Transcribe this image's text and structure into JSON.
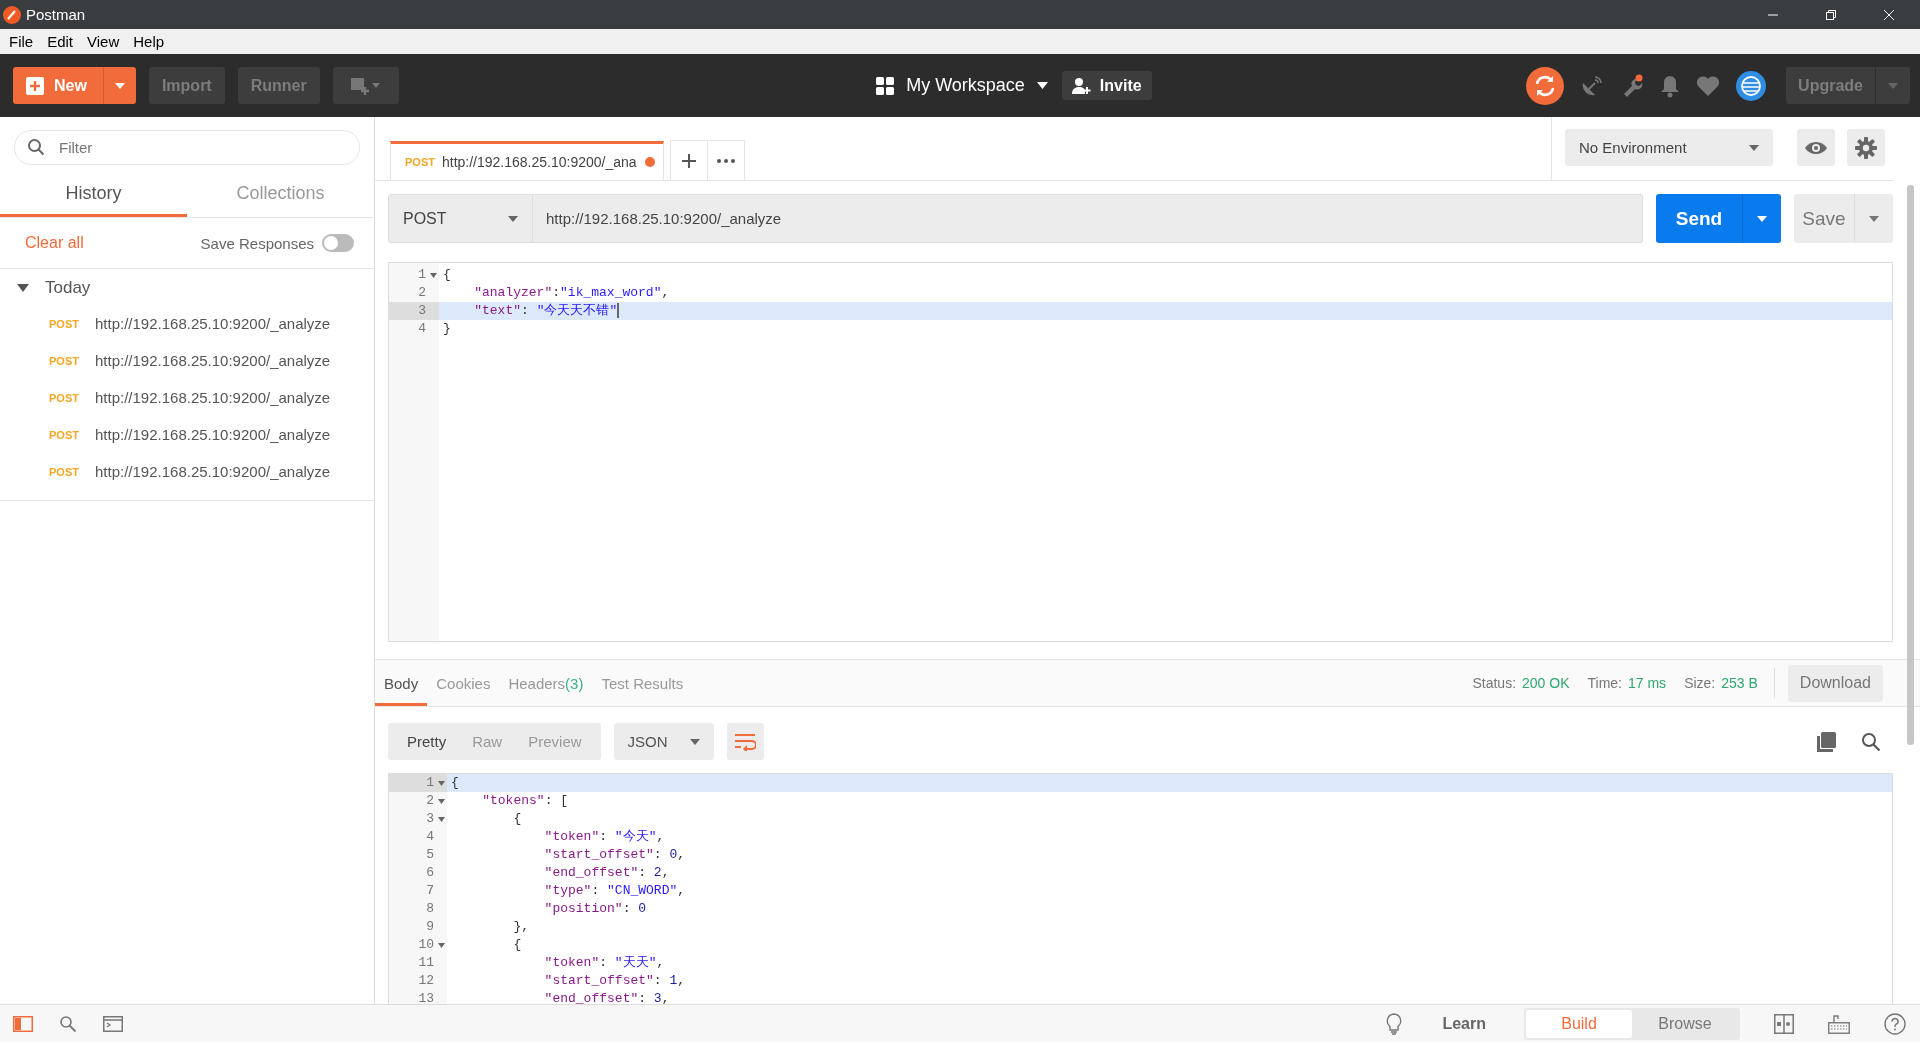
{
  "window": {
    "title": "Postman"
  },
  "menu": [
    "File",
    "Edit",
    "View",
    "Help"
  ],
  "toolbar": {
    "new_button": "New",
    "import_button": "Import",
    "runner_button": "Runner",
    "workspace": "My Workspace",
    "invite_button": "Invite",
    "upgrade_button": "Upgrade"
  },
  "sidebar": {
    "filter_placeholder": "Filter",
    "tabs": [
      {
        "label": "History",
        "selected": true
      },
      {
        "label": "Collections",
        "selected": false
      }
    ],
    "clear_all": "Clear all",
    "save_responses": {
      "label": "Save Responses",
      "on": false
    },
    "groups": [
      {
        "label": "Today",
        "expanded": true,
        "children": [
          {
            "method": "POST",
            "url": "http://192.168.25.10:9200/_analyze"
          },
          {
            "method": "POST",
            "url": "http://192.168.25.10:9200/_analyze"
          },
          {
            "method": "POST",
            "url": "http://192.168.25.10:9200/_analyze"
          },
          {
            "method": "POST",
            "url": "http://192.168.25.10:9200/_analyze"
          },
          {
            "method": "POST",
            "url": "http://192.168.25.10:9200/_analyze"
          }
        ]
      }
    ]
  },
  "request_tabs": [
    {
      "method": "POST",
      "title": "http://192.168.25.10:9200/_ana",
      "unsaved": true,
      "selected": true
    }
  ],
  "environment": {
    "value": "No Environment"
  },
  "request": {
    "method": "POST",
    "url": "http://192.168.25.10:9200/_analyze",
    "send_button": "Send",
    "save_button": "Save",
    "body_lines": [
      {
        "num": "1",
        "fold": true,
        "current": false,
        "cursor": false,
        "tokens": [
          {
            "kind": "punct",
            "text": "{"
          }
        ]
      },
      {
        "num": "2",
        "fold": false,
        "current": false,
        "cursor": false,
        "tokens": [
          {
            "kind": "key",
            "text": "    \"analyzer\""
          },
          {
            "kind": "punct",
            "text": ":"
          },
          {
            "kind": "string",
            "text": "\"ik_max_word\""
          },
          {
            "kind": "punct",
            "text": ","
          }
        ]
      },
      {
        "num": "3",
        "fold": false,
        "current": true,
        "cursor": true,
        "tokens": [
          {
            "kind": "key",
            "text": "    \"text\""
          },
          {
            "kind": "punct",
            "text": ": "
          },
          {
            "kind": "string",
            "text": "\"今天天不错\""
          }
        ]
      },
      {
        "num": "4",
        "fold": false,
        "current": false,
        "cursor": false,
        "tokens": [
          {
            "kind": "punct",
            "text": "}"
          }
        ]
      }
    ]
  },
  "response": {
    "tabs": [
      {
        "label": "Body",
        "selected": true
      },
      {
        "label": "Cookies",
        "selected": false
      },
      {
        "label": "Headers",
        "count": "(3)",
        "selected": false
      },
      {
        "label": "Test Results",
        "selected": false
      }
    ],
    "stats": [
      {
        "label": "Status:",
        "value": "200 OK"
      },
      {
        "label": "Time:",
        "value": "17 ms"
      },
      {
        "label": "Size:",
        "value": "253 B"
      }
    ],
    "download_button": "Download",
    "view_modes": [
      {
        "label": "Pretty",
        "selected": true
      },
      {
        "label": "Raw",
        "selected": false
      },
      {
        "label": "Preview",
        "selected": false
      }
    ],
    "format": "JSON",
    "body_lines": [
      {
        "num": "1",
        "fold": true,
        "current": true,
        "tokens": [
          {
            "kind": "punct",
            "text": "{"
          }
        ]
      },
      {
        "num": "2",
        "fold": true,
        "current": false,
        "tokens": [
          {
            "kind": "key",
            "text": "    \"tokens\""
          },
          {
            "kind": "punct",
            "text": ": ["
          }
        ]
      },
      {
        "num": "3",
        "fold": true,
        "current": false,
        "tokens": [
          {
            "kind": "punct",
            "text": "        {"
          }
        ]
      },
      {
        "num": "4",
        "fold": false,
        "current": false,
        "tokens": [
          {
            "kind": "key",
            "text": "            \"token\""
          },
          {
            "kind": "punct",
            "text": ": "
          },
          {
            "kind": "string",
            "text": "\"今天\""
          },
          {
            "kind": "punct",
            "text": ","
          }
        ]
      },
      {
        "num": "5",
        "fold": false,
        "current": false,
        "tokens": [
          {
            "kind": "key",
            "text": "            \"start_offset\""
          },
          {
            "kind": "punct",
            "text": ": "
          },
          {
            "kind": "number",
            "text": "0"
          },
          {
            "kind": "punct",
            "text": ","
          }
        ]
      },
      {
        "num": "6",
        "fold": false,
        "current": false,
        "tokens": [
          {
            "kind": "key",
            "text": "            \"end_offset\""
          },
          {
            "kind": "punct",
            "text": ": "
          },
          {
            "kind": "number",
            "text": "2"
          },
          {
            "kind": "punct",
            "text": ","
          }
        ]
      },
      {
        "num": "7",
        "fold": false,
        "current": false,
        "tokens": [
          {
            "kind": "key",
            "text": "            \"type\""
          },
          {
            "kind": "punct",
            "text": ": "
          },
          {
            "kind": "string",
            "text": "\"CN_WORD\""
          },
          {
            "kind": "punct",
            "text": ","
          }
        ]
      },
      {
        "num": "8",
        "fold": false,
        "current": false,
        "tokens": [
          {
            "kind": "key",
            "text": "            \"position\""
          },
          {
            "kind": "punct",
            "text": ": "
          },
          {
            "kind": "number",
            "text": "0"
          }
        ]
      },
      {
        "num": "9",
        "fold": false,
        "current": false,
        "tokens": [
          {
            "kind": "punct",
            "text": "        },"
          }
        ]
      },
      {
        "num": "10",
        "fold": true,
        "current": false,
        "tokens": [
          {
            "kind": "punct",
            "text": "        {"
          }
        ]
      },
      {
        "num": "11",
        "fold": false,
        "current": false,
        "tokens": [
          {
            "kind": "key",
            "text": "            \"token\""
          },
          {
            "kind": "punct",
            "text": ": "
          },
          {
            "kind": "string",
            "text": "\"天天\""
          },
          {
            "kind": "punct",
            "text": ","
          }
        ]
      },
      {
        "num": "12",
        "fold": false,
        "current": false,
        "tokens": [
          {
            "kind": "key",
            "text": "            \"start_offset\""
          },
          {
            "kind": "punct",
            "text": ": "
          },
          {
            "kind": "number",
            "text": "1"
          },
          {
            "kind": "punct",
            "text": ","
          }
        ]
      },
      {
        "num": "13",
        "fold": false,
        "current": false,
        "tokens": [
          {
            "kind": "key",
            "text": "            \"end_offset\""
          },
          {
            "kind": "punct",
            "text": ": "
          },
          {
            "kind": "number",
            "text": "3"
          },
          {
            "kind": "punct",
            "text": ","
          }
        ]
      }
    ]
  },
  "footer": {
    "learn": "Learn",
    "modes": [
      {
        "label": "Build",
        "selected": true
      },
      {
        "label": "Browse",
        "selected": false
      }
    ]
  }
}
